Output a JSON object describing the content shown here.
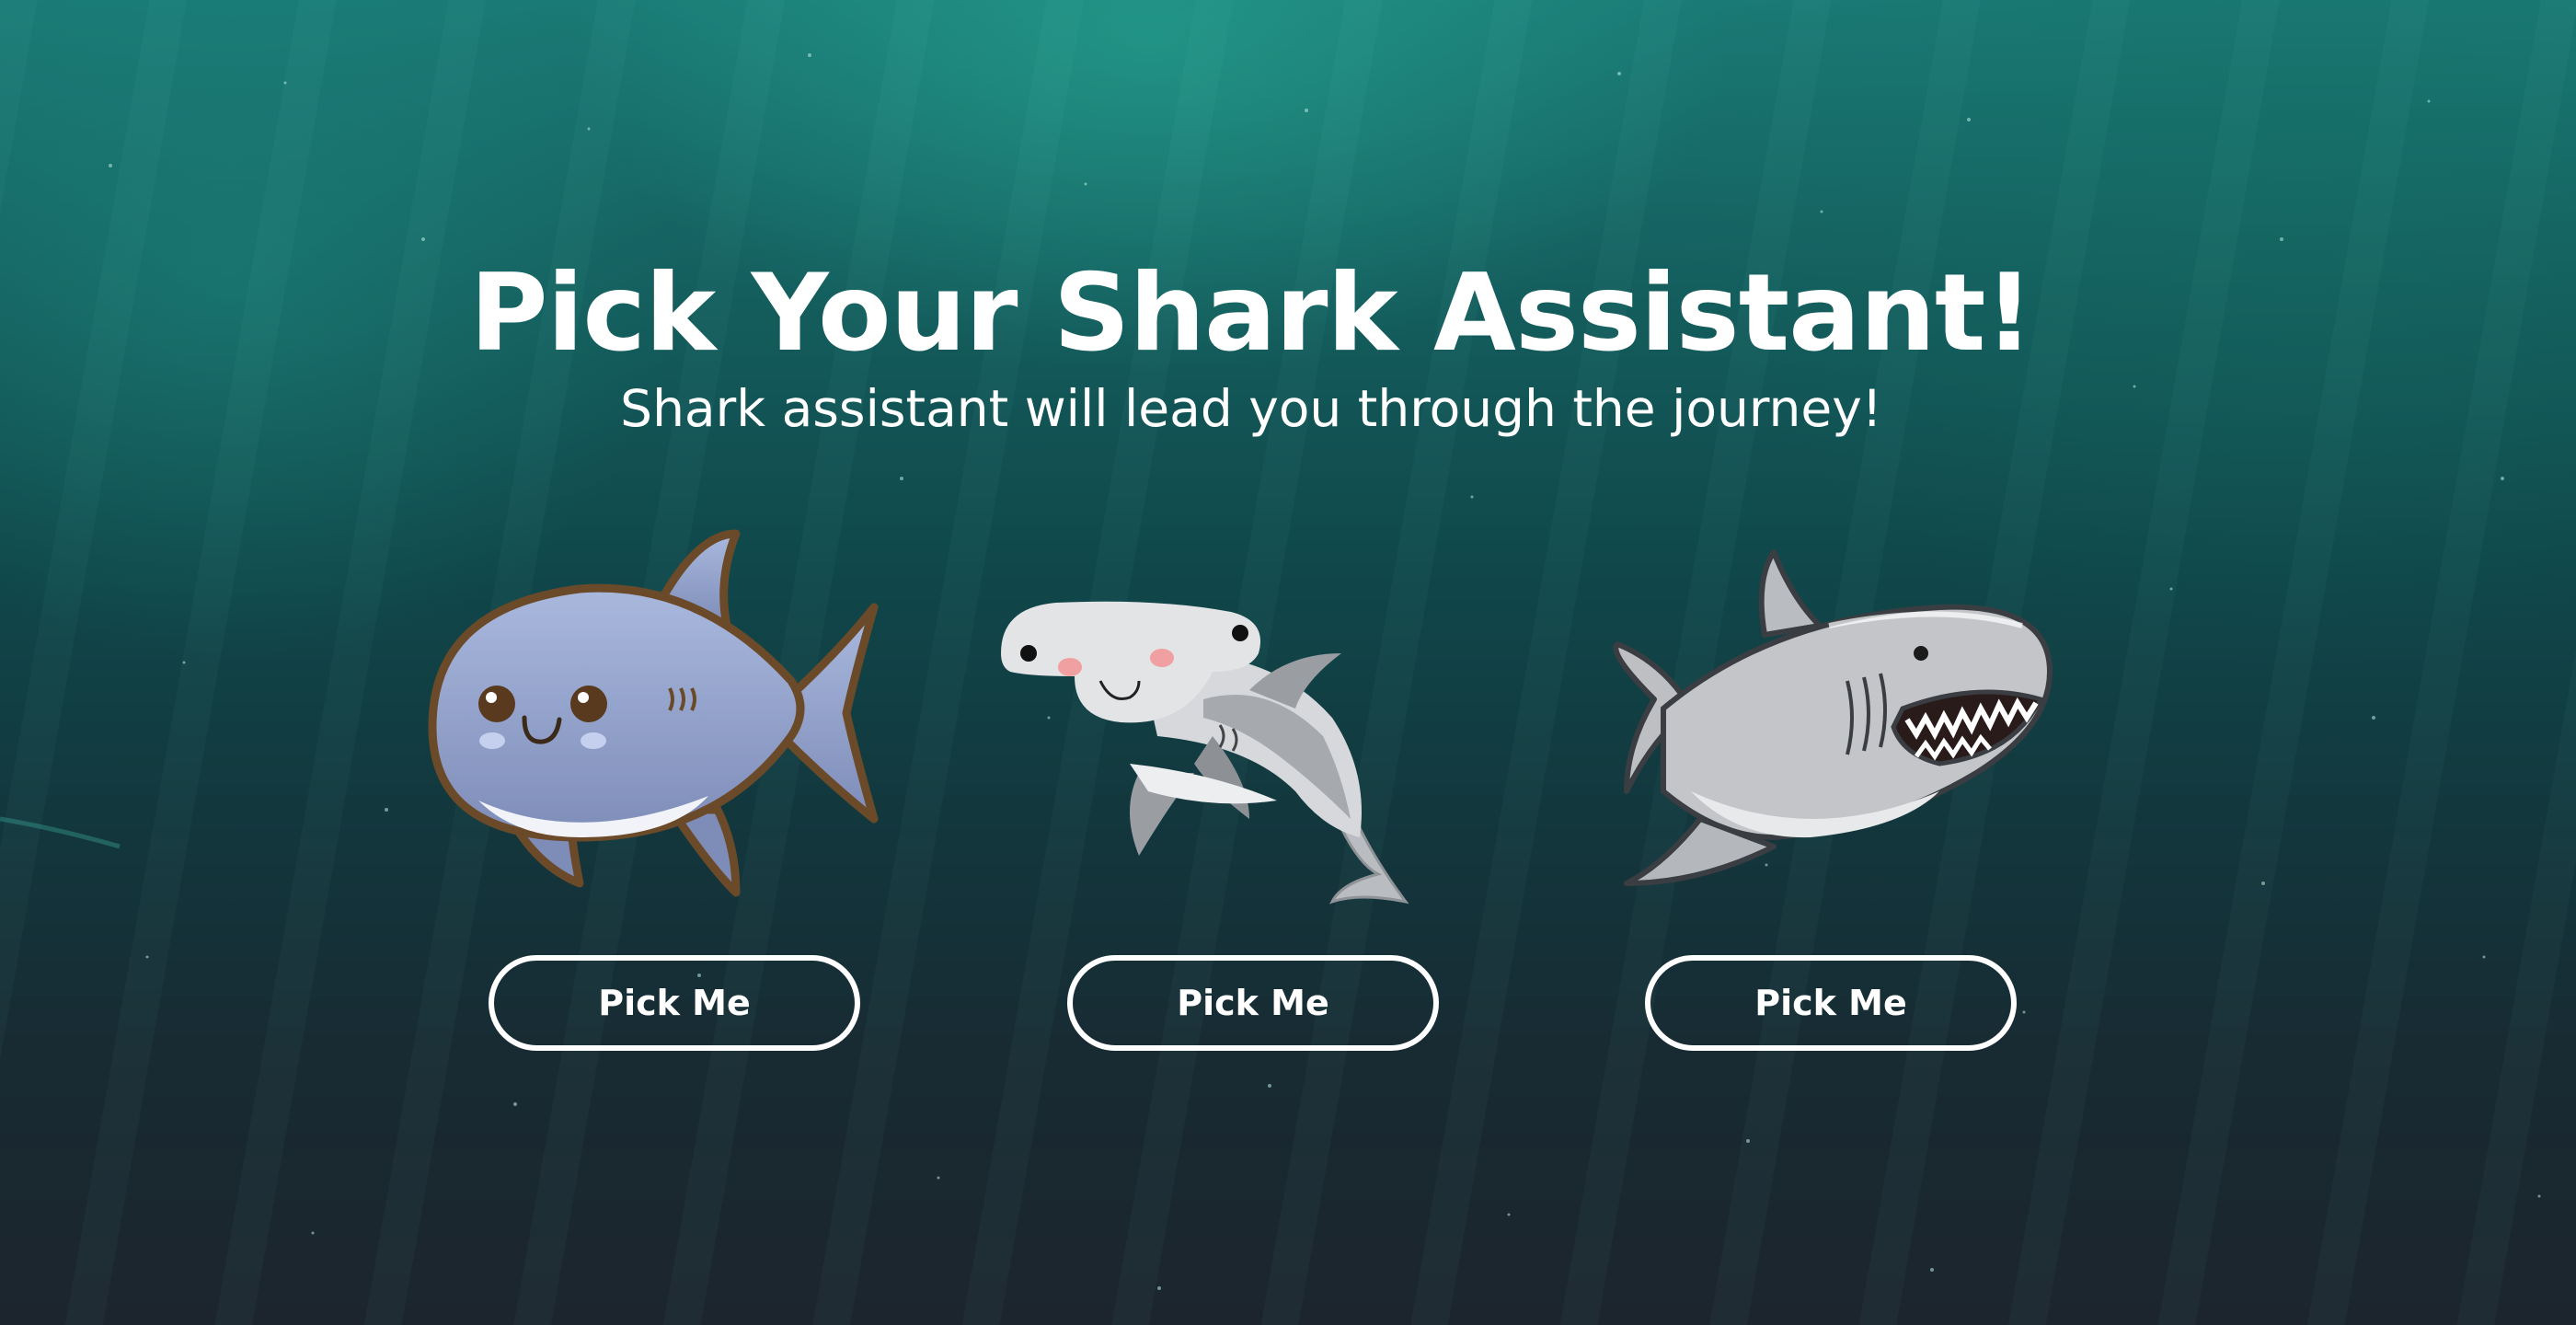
{
  "page": {
    "title": "Pick Your Shark Assistant!",
    "subtitle": "Shark assistant will lead you through the journey!"
  },
  "sharks": [
    {
      "kind": "cute-blue-shark",
      "button_label": "Pick Me"
    },
    {
      "kind": "hammerhead-shark",
      "button_label": "Pick Me"
    },
    {
      "kind": "great-white-shark",
      "button_label": "Pick Me"
    }
  ],
  "colors": {
    "background_top": "#1a7a75",
    "background_bottom": "#1c252d",
    "text": "#ffffff",
    "button_border": "#ffffff"
  }
}
